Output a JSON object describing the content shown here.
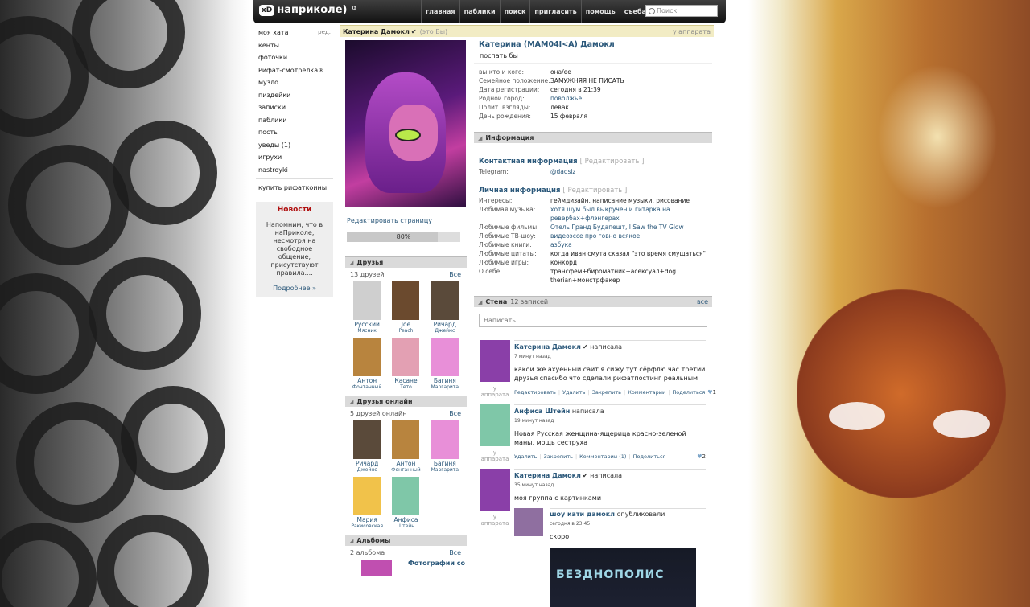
{
  "header": {
    "logo_badge": "xD",
    "logo_text": "наприколе)",
    "logo_sup": "α",
    "nav": [
      "главная",
      "паблики",
      "поиск",
      "пригласить",
      "помощь",
      "съебать"
    ],
    "search_placeholder": "Поиск"
  },
  "sidebar": {
    "items": [
      {
        "label": "моя хата",
        "extra": "ред."
      },
      {
        "label": "кенты"
      },
      {
        "label": "фоточки"
      },
      {
        "label": "Рифат-смотрелка®"
      },
      {
        "label": "музло"
      },
      {
        "label": "пиздейки"
      },
      {
        "label": "записки"
      },
      {
        "label": "паблики"
      },
      {
        "label": "посты"
      },
      {
        "label": "уведы (1)"
      },
      {
        "label": "игрухи"
      },
      {
        "label": "nastroyki"
      }
    ],
    "buy": "купить рифаткоины",
    "news": {
      "title": "Новости",
      "text": "Напомним, что в наПриколе, несмотря на свободное общение, присутствуют правила....",
      "more": "Подробнее »"
    }
  },
  "profile_header": {
    "name": "Катерина Дамокл",
    "check": "✔",
    "me": "(это Вы)",
    "status_right": "у аппарата"
  },
  "left_column": {
    "edit": "Редактировать страницу",
    "progress_label": "80%",
    "progress_fraction": 0.8,
    "friends": {
      "title": "Друзья",
      "count": "13 друзей",
      "all": "Все",
      "list": [
        {
          "n1": "Русский",
          "n2": "Мясник",
          "c": "#cfcfcf"
        },
        {
          "n1": "Joe",
          "n2": "Peach",
          "c": "#6b4a2e"
        },
        {
          "n1": "Ричард",
          "n2": "Джейнс",
          "c": "#5a4a3a"
        },
        {
          "n1": "Антон",
          "n2": "Фонтанный",
          "c": "#b8843e"
        },
        {
          "n1": "Касане",
          "n2": "Тето",
          "c": "#e3a0b3"
        },
        {
          "n1": "Багиня",
          "n2": "Маргарита",
          "c": "#e88fd8"
        }
      ]
    },
    "friends_online": {
      "title": "Друзья онлайн",
      "count": "5 друзей онлайн",
      "all": "Все",
      "list": [
        {
          "n1": "Ричард",
          "n2": "Джейнс",
          "c": "#5a4a3a"
        },
        {
          "n1": "Антон",
          "n2": "Фонтанный",
          "c": "#b8843e"
        },
        {
          "n1": "Багиня",
          "n2": "Маргарита",
          "c": "#e88fd8"
        },
        {
          "n1": "Мария",
          "n2": "Ракисовская",
          "c": "#f1c24a"
        },
        {
          "n1": "Анфиса",
          "n2": "Штейн",
          "c": "#7fc7a8"
        }
      ]
    },
    "albums": {
      "title": "Альбомы",
      "count": "2 альбома",
      "all": "Все",
      "first": "Фотографии со"
    }
  },
  "profile": {
    "fullname": "Катерина (МАМ04I<А) Дамокл",
    "status": "поспать бы",
    "basic": [
      {
        "k": "вы кто и кого:",
        "v": "она/ее"
      },
      {
        "k": "Семейное положение:",
        "v": "ЗАМУЖНЯЯ НЕ ПИСАТЬ"
      },
      {
        "k": "Дата регистрации:",
        "v": "сегодня в 21:39"
      },
      {
        "k": "Родной город:",
        "v": "поволжье",
        "link": true
      },
      {
        "k": "Полит. взгляды:",
        "v": "левак"
      },
      {
        "k": "День рождения:",
        "v": "15 февраля"
      }
    ],
    "info_title": "Информация",
    "contact_title": "Контактная информация",
    "contact_edit": "[ Редактировать ]",
    "contact": [
      {
        "k": "Telegram:",
        "v": "@daosiz",
        "link": true
      }
    ],
    "personal_title": "Личная информация",
    "personal_edit": "[ Редактировать ]",
    "personal": [
      {
        "k": "Интересы:",
        "v": "геймдизайн, написание музыки, рисование"
      },
      {
        "k": "Любимая музыка:",
        "v": "хотя шум был выкручен и гитарка на ревербах+флэнгерах",
        "link": true
      },
      {
        "k": "Любимые фильмы:",
        "v": "Отель Гранд Будапешт, I Saw the TV Glow",
        "link": true
      },
      {
        "k": "Любимые ТВ-шоу:",
        "v": "видеоэссе про говно всякое",
        "link": true
      },
      {
        "k": "Любимые книги:",
        "v": "азбука",
        "link": true
      },
      {
        "k": "Любимые цитаты:",
        "v": "когда иван смута сказал \"это время смущаться\""
      },
      {
        "k": "Любимые игры:",
        "v": "конкорд"
      },
      {
        "k": "О себе:",
        "v": "трансфем+бироматник+асексуал+dog therian+монстрфакер"
      }
    ]
  },
  "wall": {
    "title": "Стена",
    "count": "12 записей",
    "all": "все",
    "placeholder": "Написать",
    "posts": [
      {
        "author": "Катерина Дамокл",
        "check": "✔",
        "verb": "написала",
        "time": "7 минут назад",
        "text": "какой же ахуенный сайт я сижу тут сёрфлю час третий друзья спасибо что сделали рифатпостинг реальным",
        "actions": [
          "Редактировать",
          "Удалить",
          "Закрепить",
          "Комментарии",
          "Поделиться"
        ],
        "likes": "1",
        "ap": "у аппарата",
        "c": "#8a3fa8"
      },
      {
        "author": "Анфиса Штейн",
        "verb": "написала",
        "time": "19 минут назад",
        "text": "Новая Русская женщина-ящерица красно-зеленой маны, мощь сеструха",
        "actions": [
          "Удалить",
          "Закрепить",
          "Комментарии (1)",
          "Поделиться"
        ],
        "likes": "2",
        "ap": "у аппарата",
        "c": "#7fc7a8"
      },
      {
        "author": "Катерина Дамокл",
        "check": "✔",
        "verb": "написала",
        "time": "35 минут назад",
        "text": "моя группа с картинками",
        "ap": "у аппарата",
        "c": "#8a3fa8",
        "repost": {
          "author": "шоу кати дамокл",
          "verb": "опубликовали",
          "time": "сегодня в 23:45",
          "text": "скоро",
          "album_title": "БЕЗДНОПОЛИС"
        }
      }
    ]
  }
}
